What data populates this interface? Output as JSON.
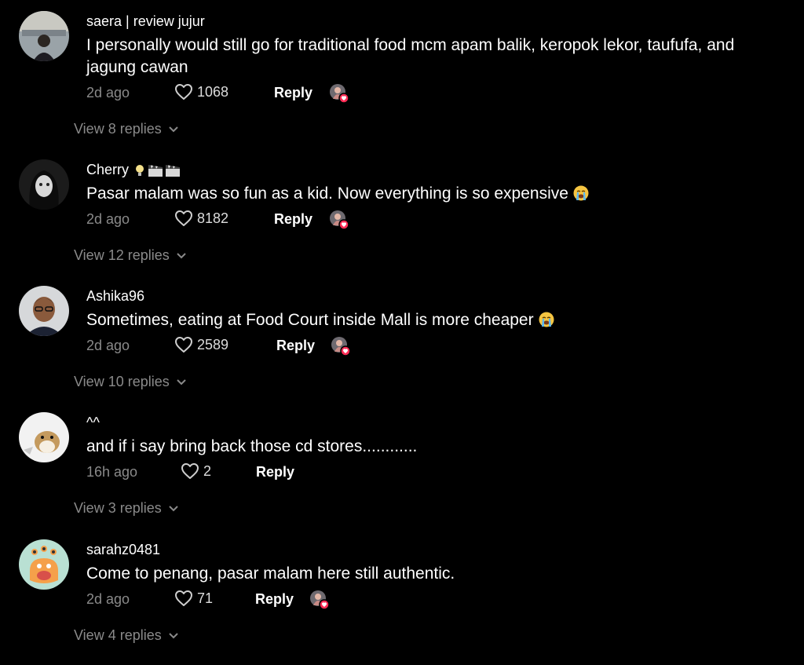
{
  "comments": [
    {
      "username": "saera | review jujur",
      "text": "I personally would still go for traditional food mcm apam balik, keropok lekor, taufufa, and jagung cawan",
      "time": "2d ago",
      "likes": "1068",
      "reply_label": "Reply",
      "view_replies": "View 8 replies",
      "creator_liked": true
    },
    {
      "username": "Cherry",
      "username_icons": [
        "lightbulb-icon",
        "clapperboard-icon",
        "clapperboard-icon"
      ],
      "text": "Pasar malam was so fun as a kid. Now everything is so expensive",
      "text_emoji": "loudly-crying-face-icon",
      "time": "2d ago",
      "likes": "8182",
      "reply_label": "Reply",
      "view_replies": "View 12 replies",
      "creator_liked": true
    },
    {
      "username": "Ashika96",
      "text": "Sometimes, eating at Food Court inside Mall is more cheaper",
      "text_emoji": "loudly-crying-face-icon",
      "time": "2d ago",
      "likes": "2589",
      "reply_label": "Reply",
      "view_replies": "View 10 replies",
      "creator_liked": true
    },
    {
      "username": "^^",
      "text": "and if i say bring back those cd stores............",
      "time": "16h ago",
      "likes": "2",
      "reply_label": "Reply",
      "view_replies": "View 3 replies",
      "creator_liked": false
    },
    {
      "username": "sarahz0481",
      "text": "Come to penang, pasar malam here still authentic.",
      "time": "2d ago",
      "likes": "71",
      "reply_label": "Reply",
      "view_replies": "View 4 replies",
      "creator_liked": true
    }
  ],
  "colors": {
    "background": "#000000",
    "text": "#ffffff",
    "secondary_text": "#8a8a8a",
    "creator_heart": "#fe2c55"
  }
}
